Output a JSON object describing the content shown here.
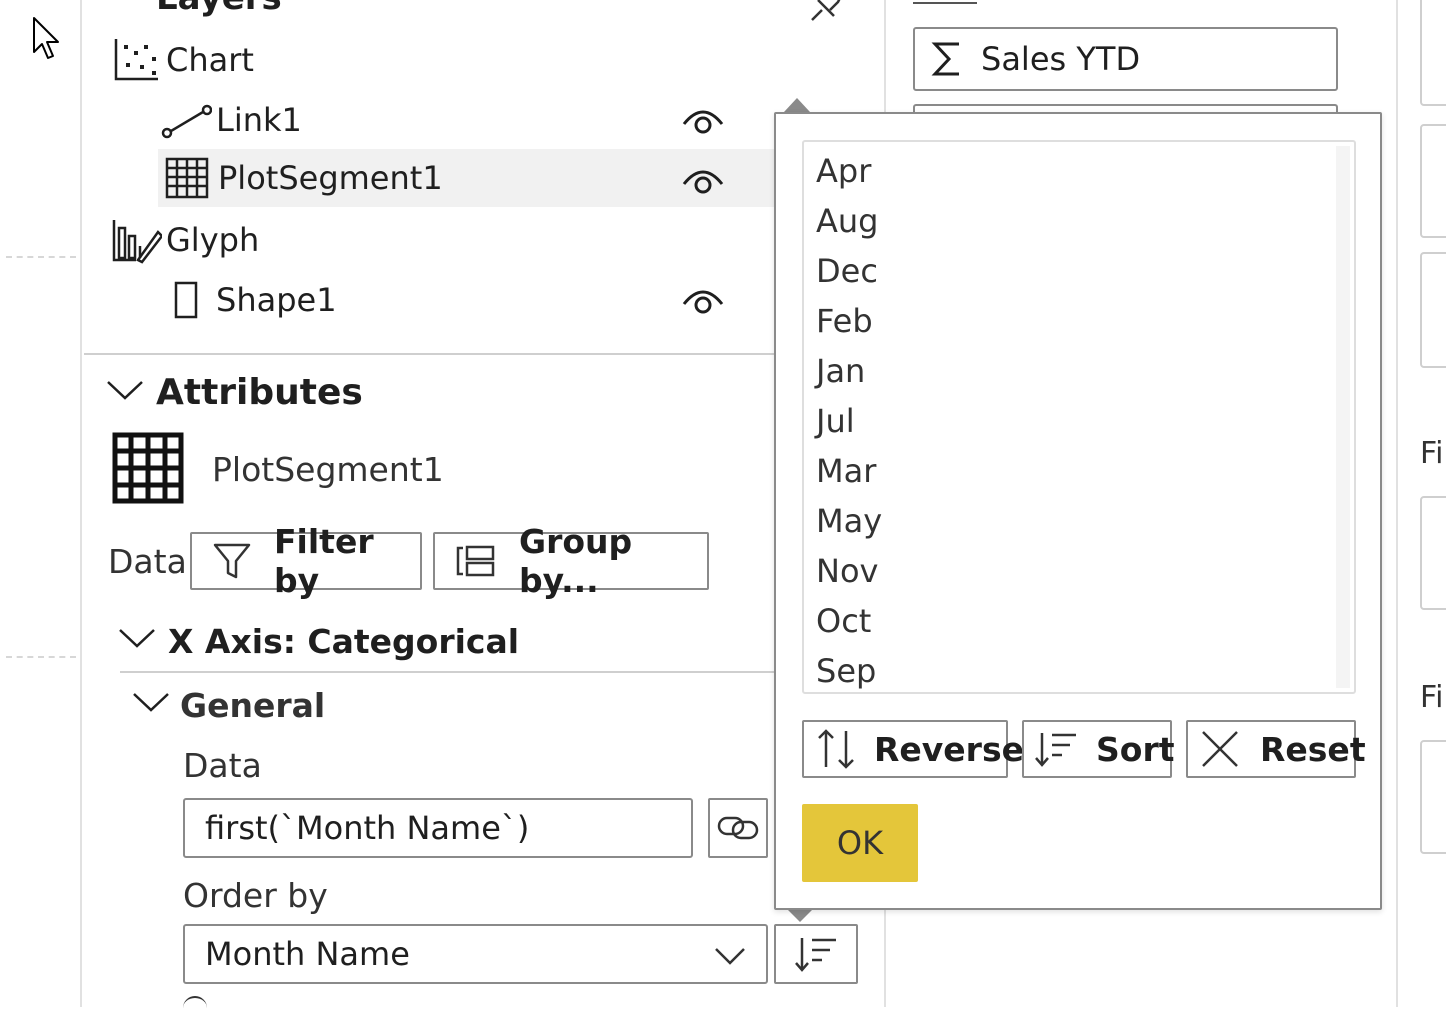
{
  "layers": {
    "title": "Layers",
    "items": [
      {
        "label": "Chart",
        "icon": "scatter-chart-icon"
      },
      {
        "label": "Link1",
        "icon": "link-line-icon"
      },
      {
        "label": "PlotSegment1",
        "icon": "grid-icon"
      },
      {
        "label": "Glyph",
        "icon": "glyph-icon"
      },
      {
        "label": "Shape1",
        "icon": "rectangle-icon"
      }
    ]
  },
  "attributes": {
    "title": "Attributes",
    "object_name": "PlotSegment1",
    "data_label": "Data",
    "filter_label": "Filter by",
    "group_label": "Group by...",
    "x_axis_title": "X Axis: Categorical",
    "general_title": "General",
    "general_data_label": "Data",
    "data_expression": "first(`Month Name`)",
    "order_by_label": "Order by",
    "order_by_value": "Month Name"
  },
  "right_panel": {
    "measure_label": "Sales YTD",
    "fi_label_1": "Fi",
    "fi_label_2": "Fi"
  },
  "sort_popup": {
    "items": [
      "Apr",
      "Aug",
      "Dec",
      "Feb",
      "Jan",
      "Jul",
      "Mar",
      "May",
      "Nov",
      "Oct",
      "Sep"
    ],
    "reverse_label": "Reverse",
    "sort_label": "Sort",
    "reset_label": "Reset",
    "ok_label": "OK"
  },
  "colors": {
    "ok_button": "#e4c63a",
    "selected_row": "#f1f1f1",
    "border": "#8a8a8a"
  }
}
